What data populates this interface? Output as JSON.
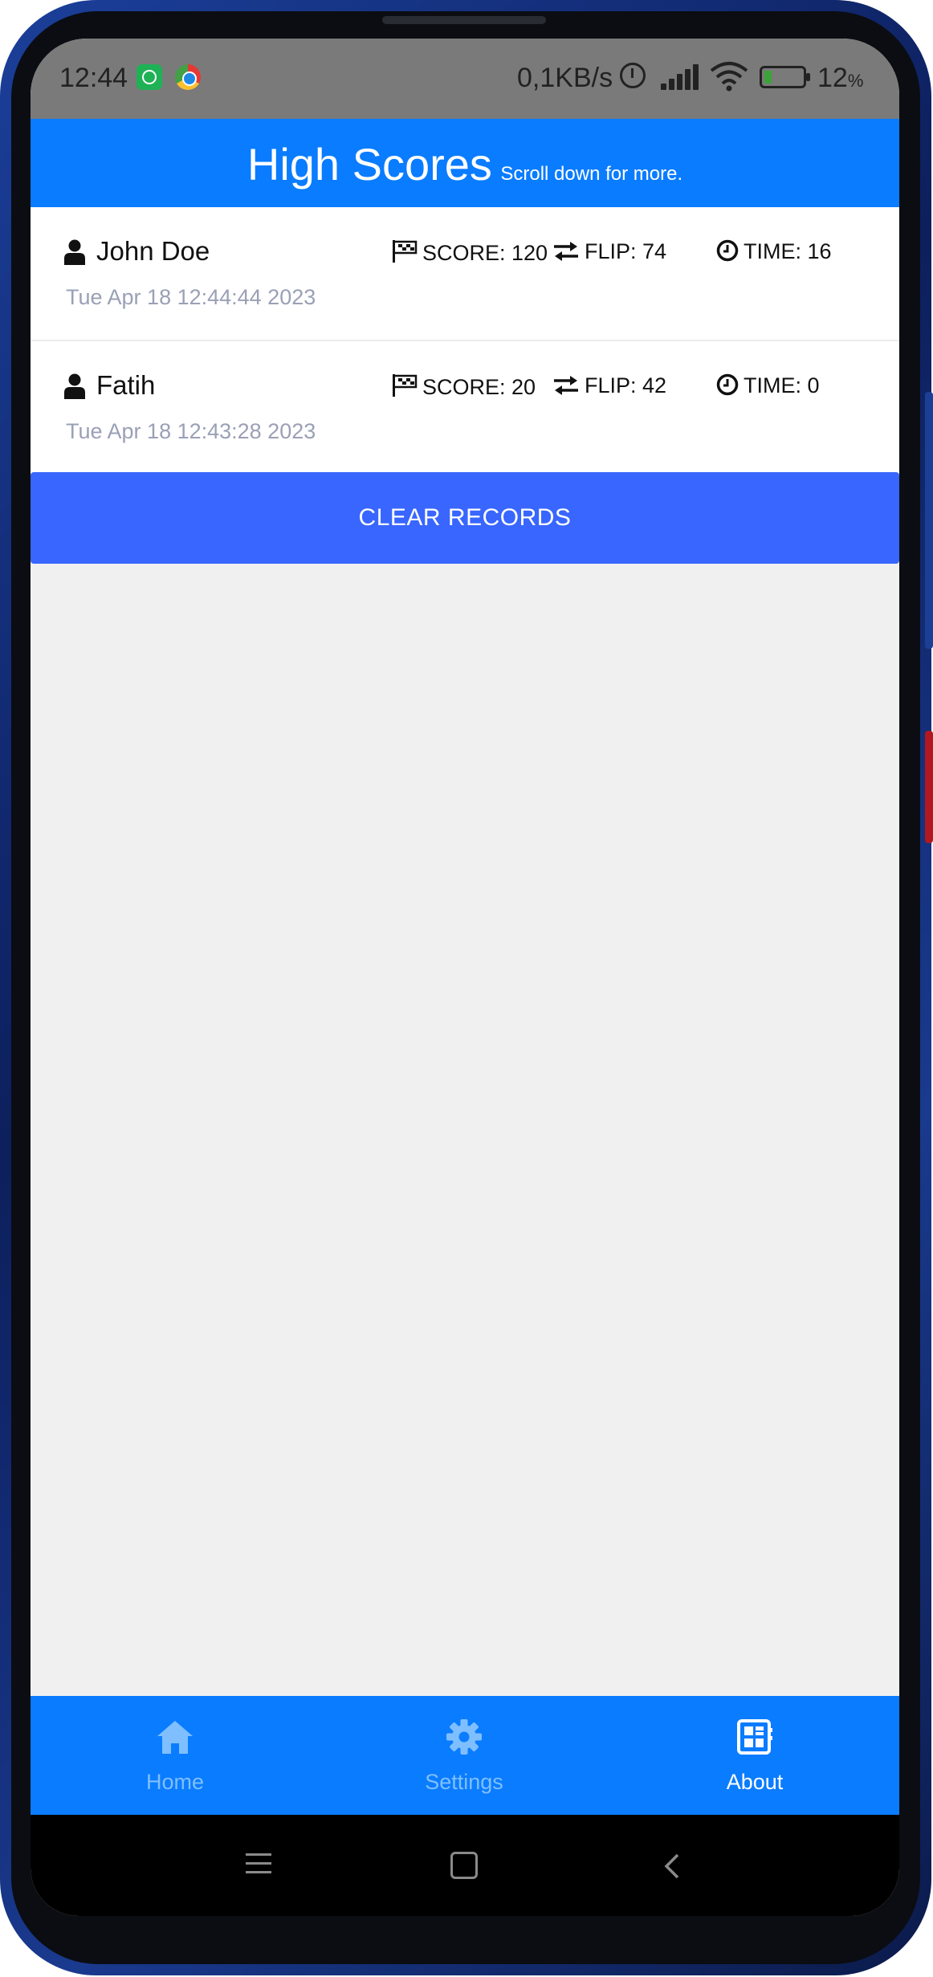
{
  "status_bar": {
    "time": "12:44",
    "network_speed": "0,1KB/s",
    "battery_percent": "12",
    "battery_unit": "%",
    "icons": [
      "whatsapp-icon",
      "chrome-icon",
      "alarm-icon",
      "signal-icon",
      "wifi-icon",
      "battery-charging-icon"
    ]
  },
  "header": {
    "title": "High Scores",
    "subtitle": "Scroll down for more."
  },
  "records": [
    {
      "name": "John Doe",
      "score": "SCORE: 120",
      "flip": "FLIP: 74",
      "time": "TIME: 16",
      "date": "Tue Apr 18 12:44:44 2023"
    },
    {
      "name": "Fatih",
      "score": "SCORE: 20",
      "flip": "FLIP: 42",
      "time": "TIME: 0",
      "date": "Tue Apr 18 12:43:28 2023"
    }
  ],
  "clear_button": {
    "label": "CLEAR RECORDS"
  },
  "tabs": [
    {
      "label": "Home",
      "icon": "home-icon",
      "active": false
    },
    {
      "label": "Settings",
      "icon": "gear-icon",
      "active": false
    },
    {
      "label": "About",
      "icon": "about-icon",
      "active": true
    }
  ],
  "colors": {
    "primary": "#0a7cff",
    "button": "#3866ff",
    "tab_inactive": "#7fbfff",
    "date_text": "#9aa0b5",
    "background": "#f0f0f0"
  }
}
